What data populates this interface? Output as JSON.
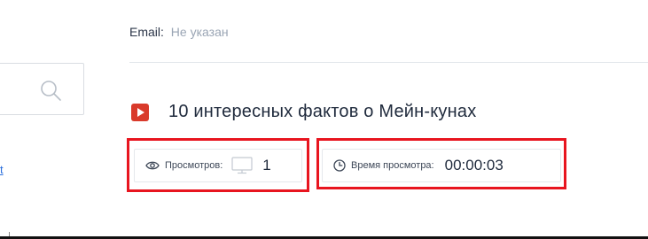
{
  "profile": {
    "email_label": "Email:",
    "email_value": "Не указан"
  },
  "search": {
    "icon": "search-icon"
  },
  "left_link": {
    "text": "t"
  },
  "video": {
    "icon": "video-play-icon",
    "title": "10 интересных фактов о Мейн-кунах",
    "views_label": "Просмотров:",
    "views_count": "1",
    "watch_time_label": "Время просмотра:",
    "watch_time_value": "00:00:03"
  },
  "colors": {
    "accent_red": "#d93a2b",
    "highlight_red": "#e8151f",
    "link_blue": "#2a6edb",
    "muted_text": "#9aa5b4"
  }
}
